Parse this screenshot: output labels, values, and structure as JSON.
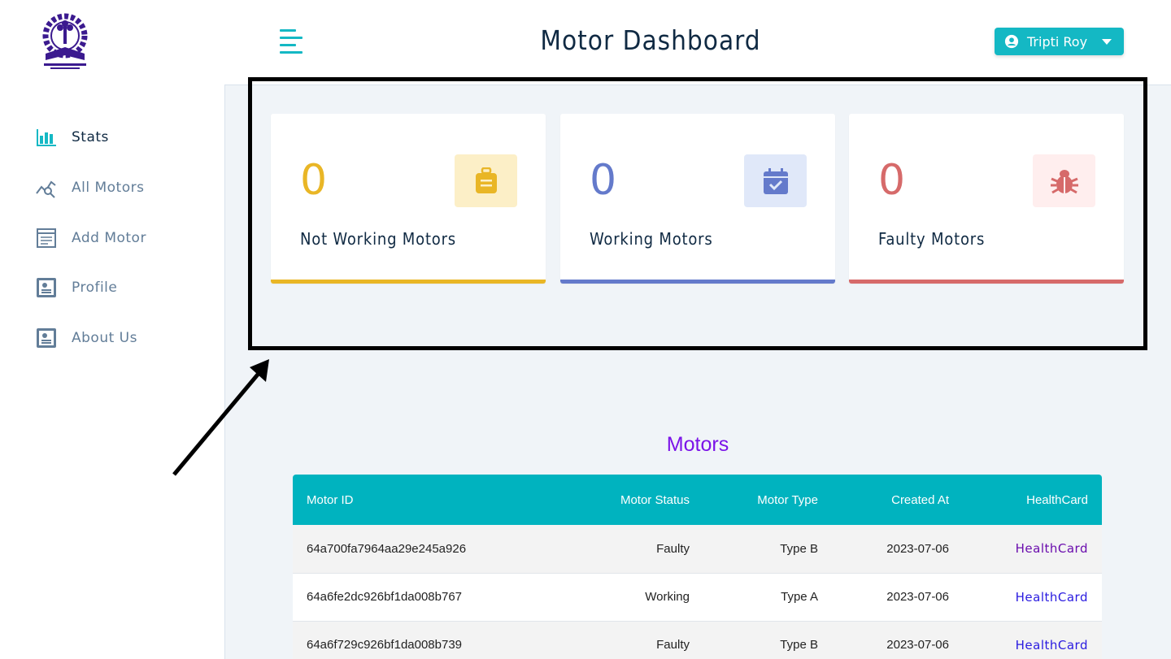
{
  "header": {
    "title": "Motor Dashboard",
    "user_name": "Tripti Roy"
  },
  "sidebar": {
    "items": [
      {
        "label": "Stats",
        "icon": "bar-chart-icon",
        "active": true
      },
      {
        "label": "All Motors",
        "icon": "line-chart-search-icon",
        "active": false
      },
      {
        "label": "Add Motor",
        "icon": "form-icon",
        "active": false
      },
      {
        "label": "Profile",
        "icon": "profile-card-icon",
        "active": false
      },
      {
        "label": "About Us",
        "icon": "profile-card-icon",
        "active": false
      }
    ]
  },
  "stats": [
    {
      "count": "0",
      "label": "Not Working Motors",
      "icon": "suitcase-icon",
      "color": "#e9b626",
      "bg": "#fcefc7"
    },
    {
      "count": "0",
      "label": "Working Motors",
      "icon": "calendar-check-icon",
      "color": "#647acb",
      "bg": "#e0e8f9"
    },
    {
      "count": "0",
      "label": "Faulty Motors",
      "icon": "bug-icon",
      "color": "#d66a6a",
      "bg": "#ffeeee"
    }
  ],
  "motors": {
    "heading": "Motors",
    "columns": [
      "Motor ID",
      "Motor Status",
      "Motor Type",
      "Created At",
      "HealthCard"
    ],
    "rows": [
      {
        "id": "64a700fa7964aa29e245a926",
        "status": "Faulty",
        "type": "Type B",
        "created": "2023-07-06",
        "link": "HealthCard",
        "link_color": "#6a0dad"
      },
      {
        "id": "64a6fe2dc926bf1da008b767",
        "status": "Working",
        "type": "Type A",
        "created": "2023-07-06",
        "link": "HealthCard",
        "link_color": "#2a1be0"
      },
      {
        "id": "64a6f729c926bf1da008b739",
        "status": "Faulty",
        "type": "Type B",
        "created": "2023-07-06",
        "link": "HealthCard",
        "link_color": "#2a1be0"
      }
    ]
  },
  "colors": {
    "accent": "#14b8c4",
    "heading_purple": "#7b13e8",
    "table_header": "#00b3bf"
  }
}
